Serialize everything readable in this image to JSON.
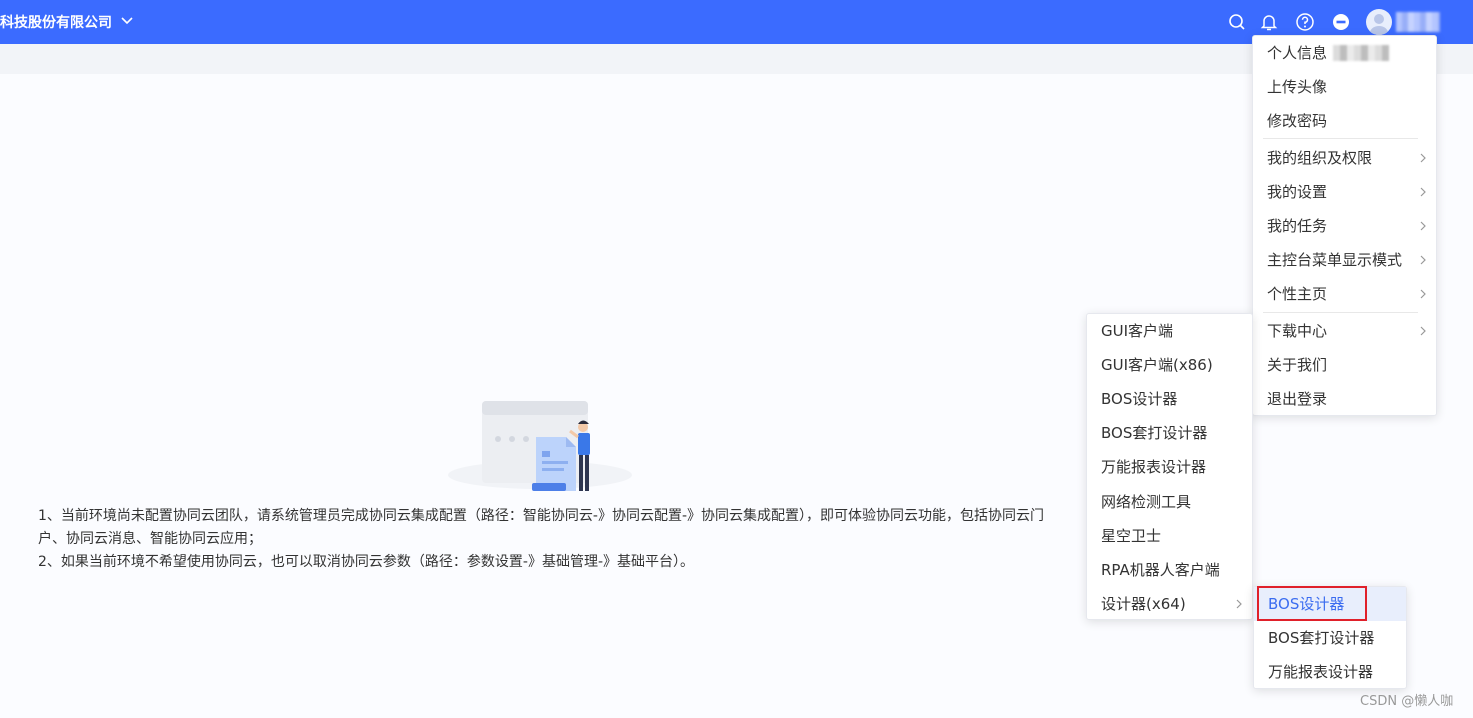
{
  "header": {
    "company_name": "科技股份有限公司",
    "icons": [
      "search-icon",
      "bell-icon",
      "help-icon",
      "minus-circle-icon",
      "user-avatar"
    ],
    "bg_color": "#3b6bff"
  },
  "notice": {
    "line1": "1、当前环境尚未配置协同云团队，请系统管理员完成协同云集成配置（路径：智能协同云-》协同云配置-》协同云集成配置），即可体验协同云功能，包括协同云门户、协同云消息、智能协同云应用；",
    "line2": "2、如果当前环境不希望使用协同云，也可以取消协同云参数（路径：参数设置-》基础管理-》基础平台）。"
  },
  "user_menu": {
    "items": [
      {
        "label": "个人信息"
      },
      {
        "label": "上传头像"
      },
      {
        "label": "修改密码"
      },
      {
        "label": "我的组织及权限",
        "has_submenu": true
      },
      {
        "label": "我的设置",
        "has_submenu": true
      },
      {
        "label": "我的任务",
        "has_submenu": true
      },
      {
        "label": "主控台菜单显示模式",
        "has_submenu": true
      },
      {
        "label": "个性主页",
        "has_submenu": true
      },
      {
        "label": "下载中心",
        "has_submenu": true
      },
      {
        "label": "关于我们"
      },
      {
        "label": "退出登录"
      }
    ]
  },
  "download_submenu": {
    "items": [
      {
        "label": "GUI客户端"
      },
      {
        "label": "GUI客户端(x86)"
      },
      {
        "label": "BOS设计器"
      },
      {
        "label": "BOS套打设计器"
      },
      {
        "label": "万能报表设计器"
      },
      {
        "label": "网络检测工具"
      },
      {
        "label": "星空卫士"
      },
      {
        "label": "RPA机器人客户端"
      },
      {
        "label": "设计器(x64)",
        "has_submenu": true
      }
    ]
  },
  "designer_submenu": {
    "items": [
      {
        "label": "BOS设计器",
        "selected": true
      },
      {
        "label": "BOS套打设计器"
      },
      {
        "label": "万能报表设计器"
      }
    ],
    "highlight_color": "#e0202a",
    "selected_text_color": "#3a6cf0"
  },
  "watermark": "CSDN @懒人咖"
}
